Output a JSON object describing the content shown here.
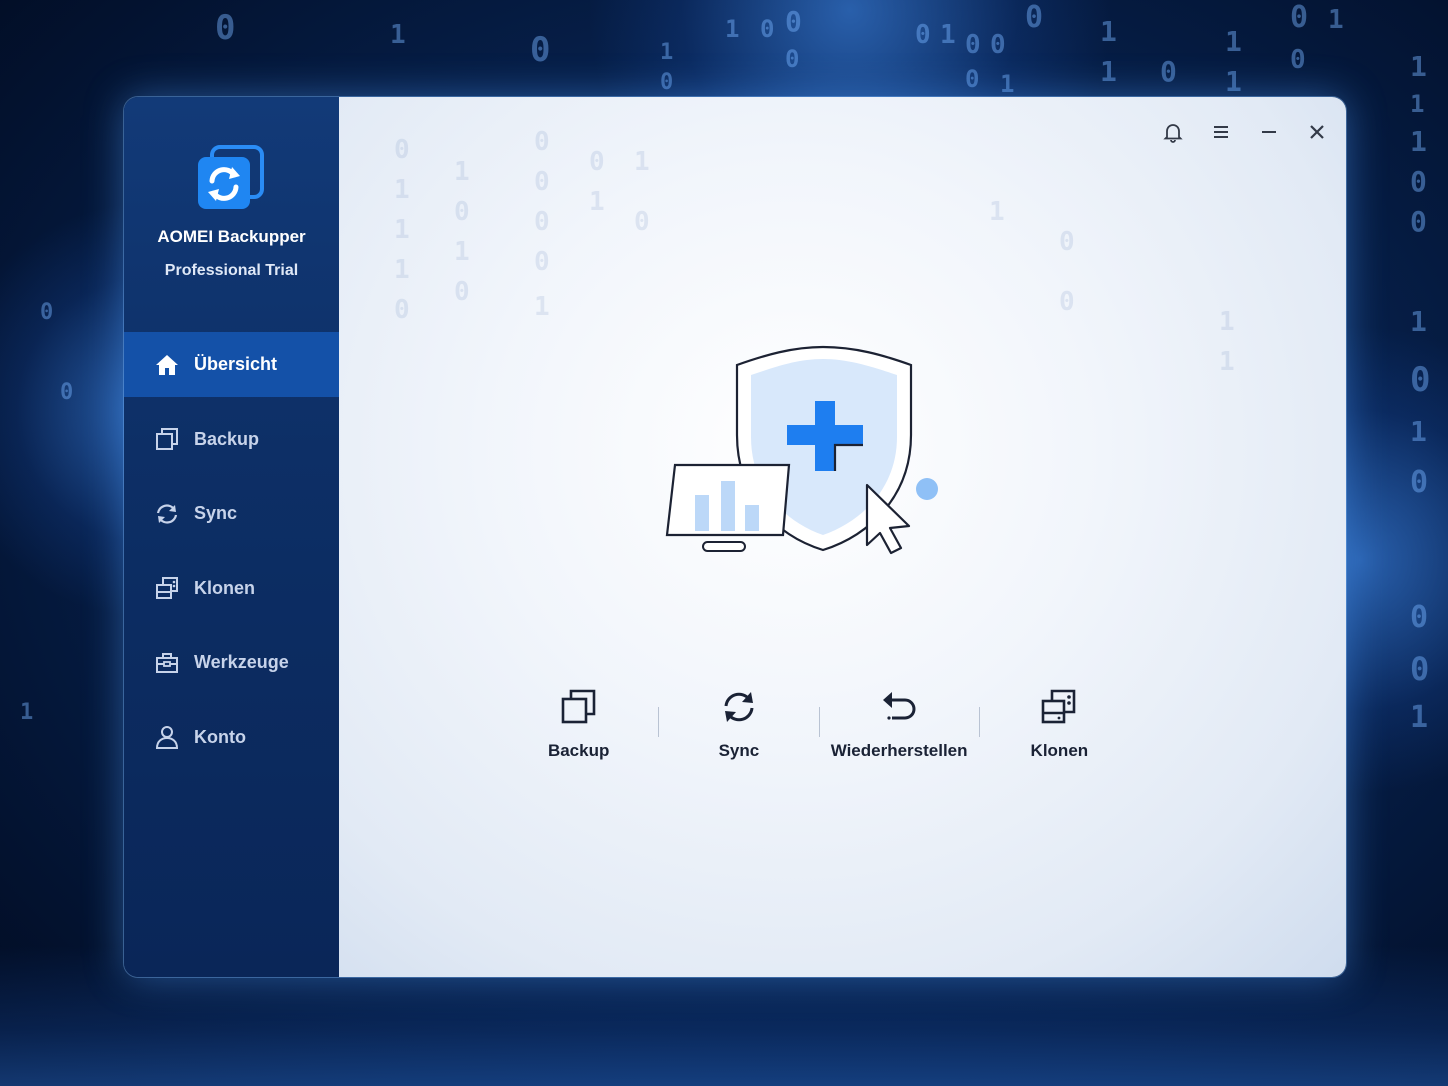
{
  "app": {
    "name": "AOMEI Backupper",
    "edition": "Professional Trial"
  },
  "sidebar": {
    "items": [
      {
        "label": "Übersicht",
        "icon": "home-icon",
        "active": true
      },
      {
        "label": "Backup",
        "icon": "backup-icon",
        "active": false
      },
      {
        "label": "Sync",
        "icon": "sync-icon",
        "active": false
      },
      {
        "label": "Klonen",
        "icon": "clone-icon",
        "active": false
      },
      {
        "label": "Werkzeuge",
        "icon": "toolbox-icon",
        "active": false
      },
      {
        "label": "Konto",
        "icon": "user-icon",
        "active": false
      }
    ]
  },
  "titlebar": {
    "icons": [
      "bell-icon",
      "menu-icon",
      "minimize-icon",
      "close-icon"
    ]
  },
  "actions": [
    {
      "label": "Backup",
      "icon": "backup-icon"
    },
    {
      "label": "Sync",
      "icon": "sync-icon"
    },
    {
      "label": "Wiederherstellen",
      "icon": "restore-icon"
    },
    {
      "label": "Klonen",
      "icon": "clone-icon"
    }
  ],
  "colors": {
    "sidebar": "#0d2f66",
    "active_nav": "#1451a8",
    "accent": "#1e7ef0",
    "main_bg": "#f1f5fb"
  }
}
